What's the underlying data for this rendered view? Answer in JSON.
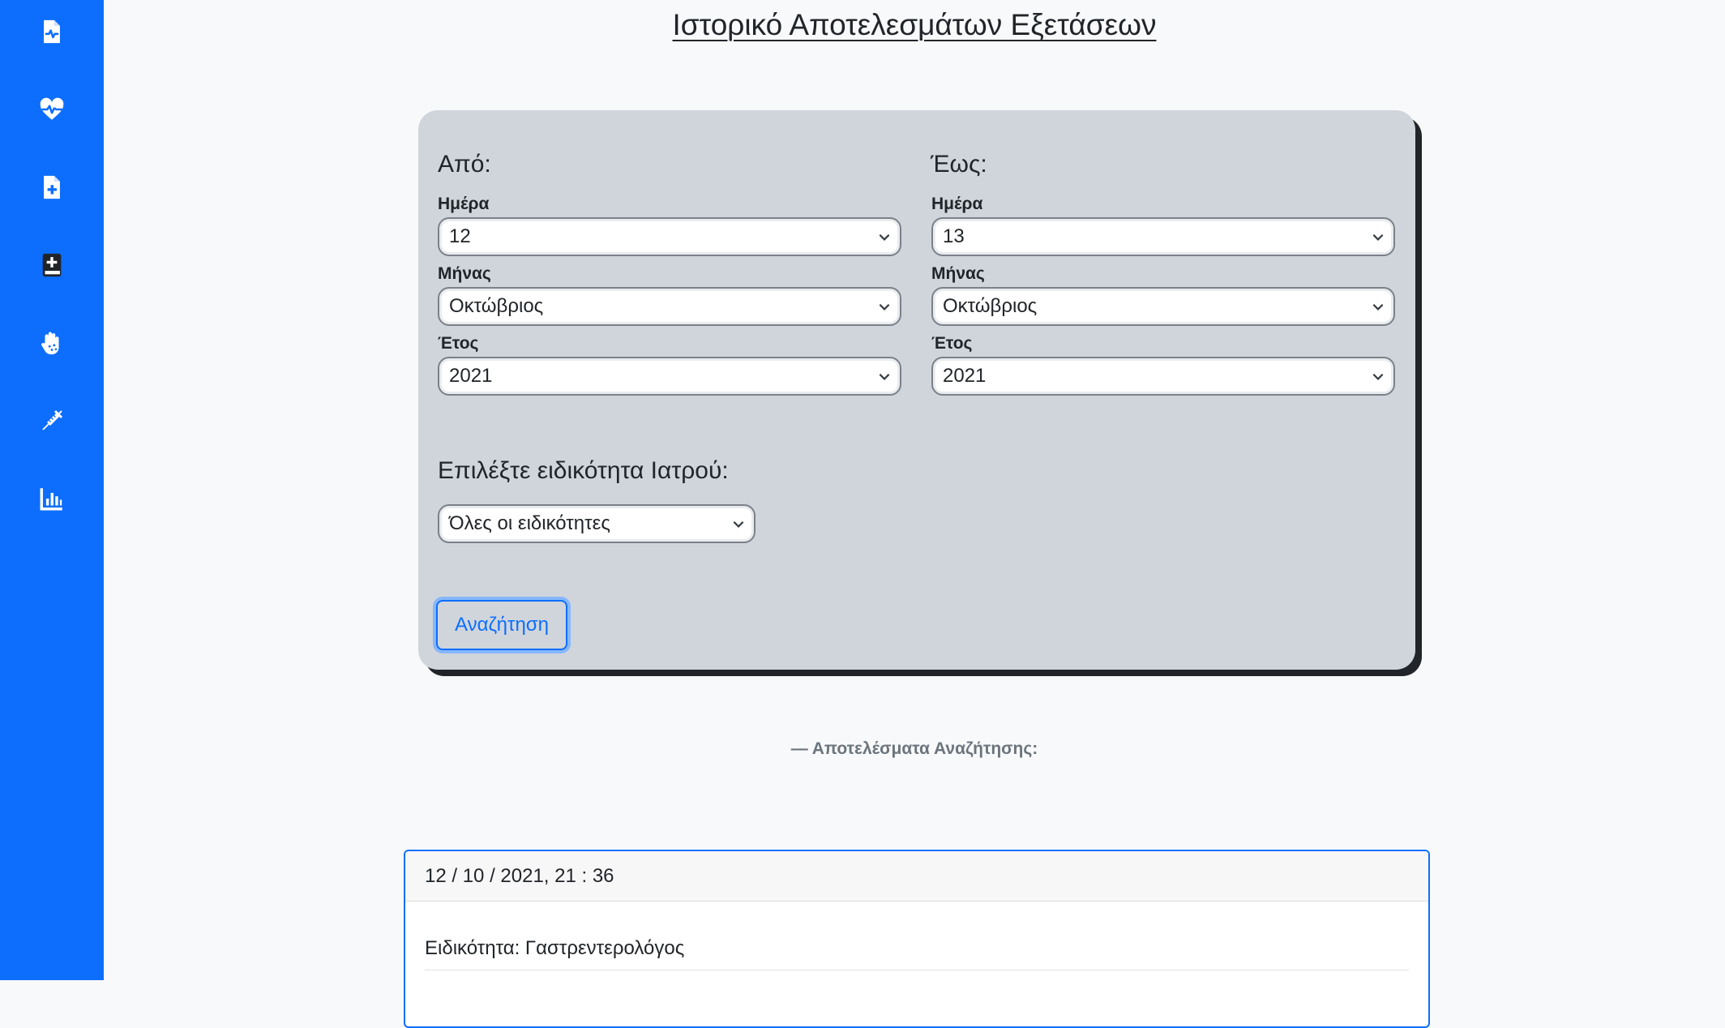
{
  "sidebar": {
    "items": [
      {
        "icon": "medical-file-icon"
      },
      {
        "icon": "heartbeat-icon"
      },
      {
        "icon": "file-plus-icon"
      },
      {
        "icon": "medical-book-icon"
      },
      {
        "icon": "allergy-hand-icon"
      },
      {
        "icon": "syringe-icon"
      },
      {
        "icon": "bar-chart-icon"
      }
    ],
    "color": "#0d6efd"
  },
  "page": {
    "title": "Ιστορικό Αποτελεσμάτων Εξετάσεων"
  },
  "filters": {
    "from": {
      "heading": "Από:",
      "day_label": "Ημέρα",
      "day_value": "12",
      "month_label": "Μήνας",
      "month_value": "Οκτώβριος",
      "year_label": "Έτος",
      "year_value": "2021"
    },
    "to": {
      "heading": "Έως:",
      "day_label": "Ημέρα",
      "day_value": "13",
      "month_label": "Μήνας",
      "month_value": "Οκτώβριος",
      "year_label": "Έτος",
      "year_value": "2021"
    },
    "specialty": {
      "heading": "Επιλέξτε ειδικότητα Ιατρού:",
      "value": "Όλες οι ειδικότητες"
    },
    "search_label": "Αναζήτηση"
  },
  "results": {
    "heading": "— Αποτελέσματα Αναζήτησης:",
    "items": [
      {
        "datetime": "12 / 10 / 2021, 21 : 36",
        "specialty_line": "Ειδικότητα: Γαστρεντερολόγος"
      }
    ]
  }
}
